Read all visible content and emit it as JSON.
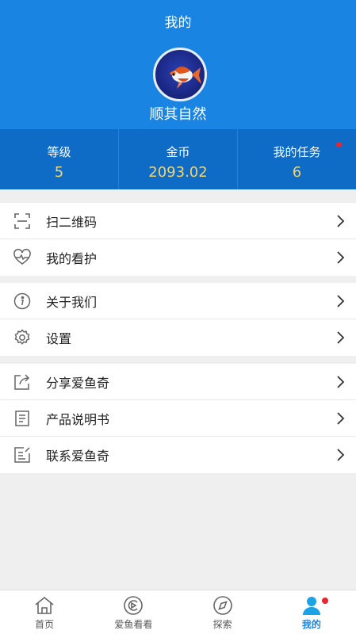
{
  "header": {
    "title": "我的",
    "username": "顺其自然",
    "avatar_icon": "goldfish-avatar"
  },
  "stats": [
    {
      "label": "等级",
      "value": "5"
    },
    {
      "label": "金币",
      "value": "2093.02"
    },
    {
      "label": "我的任务",
      "value": "6",
      "has_badge": true
    }
  ],
  "menu_groups": [
    [
      {
        "label": "扫二维码",
        "icon": "scan-qr-icon"
      },
      {
        "label": "我的看护",
        "icon": "heart-pulse-icon"
      }
    ],
    [
      {
        "label": "关于我们",
        "icon": "info-icon"
      },
      {
        "label": "设置",
        "icon": "gear-icon"
      }
    ],
    [
      {
        "label": "分享爱鱼奇",
        "icon": "share-icon"
      },
      {
        "label": "产品说明书",
        "icon": "manual-icon"
      },
      {
        "label": "联系爱鱼奇",
        "icon": "contact-icon"
      }
    ]
  ],
  "tabs": [
    {
      "label": "首页",
      "icon": "home-icon",
      "active": false
    },
    {
      "label": "爱鱼看看",
      "icon": "camera-play-icon",
      "active": false
    },
    {
      "label": "探索",
      "icon": "compass-icon",
      "active": false
    },
    {
      "label": "我的",
      "icon": "user-icon",
      "active": true,
      "has_badge": true
    }
  ],
  "colors": {
    "header_bg": "#1a84e2",
    "stats_bg": "#0f6cc6",
    "stat_value": "#f3d36b",
    "badge": "#e8262d",
    "active_tab": "#1a84e2"
  }
}
